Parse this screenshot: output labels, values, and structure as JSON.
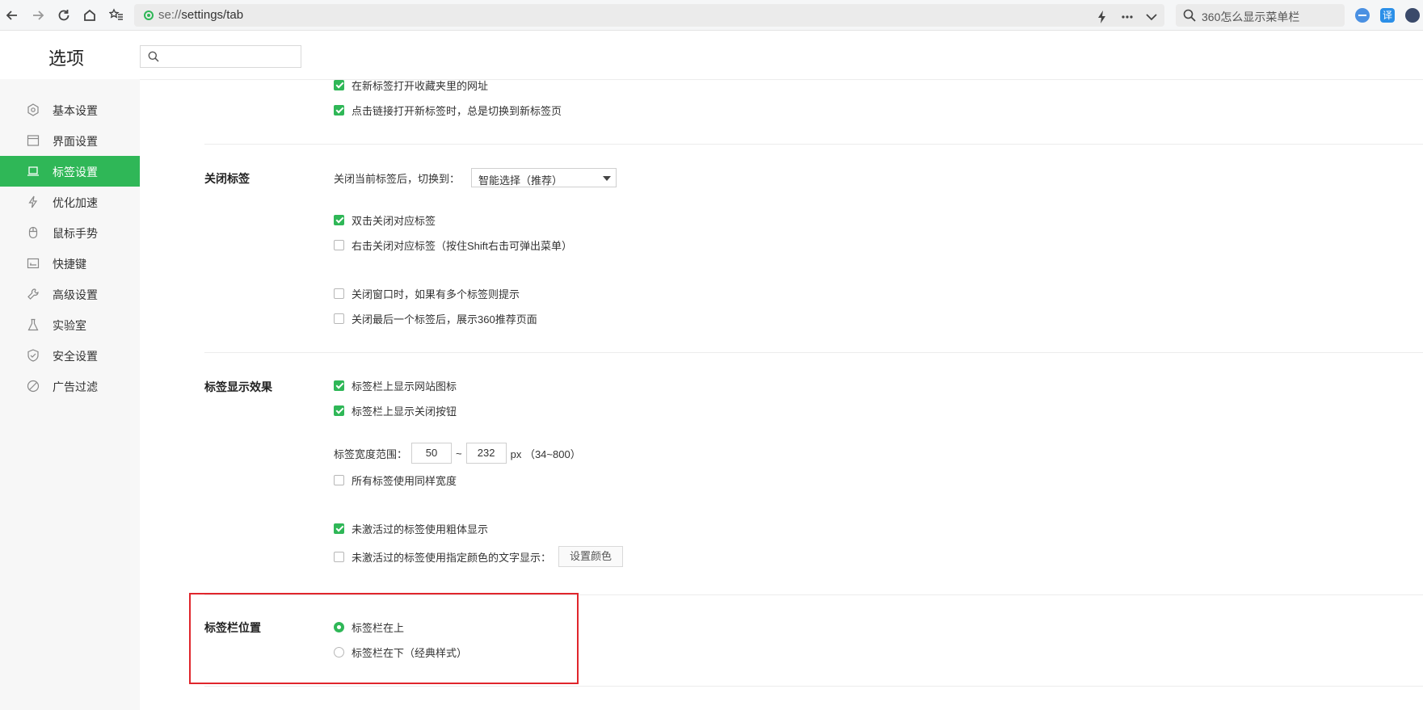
{
  "browser": {
    "url_scheme": "se://",
    "url_rest": "settings/tab",
    "search_text": "360怎么显示菜单栏",
    "translate_label": "译"
  },
  "header": {
    "title": "选项",
    "search_placeholder": ""
  },
  "sidebar": {
    "items": [
      {
        "label": "基本设置",
        "icon": "gear-icon"
      },
      {
        "label": "界面设置",
        "icon": "window-icon"
      },
      {
        "label": "标签设置",
        "icon": "tab-icon",
        "active": true
      },
      {
        "label": "优化加速",
        "icon": "lightning-icon"
      },
      {
        "label": "鼠标手势",
        "icon": "mouse-icon"
      },
      {
        "label": "快捷键",
        "icon": "keyboard-icon"
      },
      {
        "label": "高级设置",
        "icon": "wrench-icon"
      },
      {
        "label": "实验室",
        "icon": "flask-icon"
      },
      {
        "label": "安全设置",
        "icon": "shield-icon"
      },
      {
        "label": "广告过滤",
        "icon": "block-icon"
      }
    ]
  },
  "open_section": {
    "items": [
      {
        "label": "在新标签打开收藏夹里的网址",
        "checked": true
      },
      {
        "label": "点击链接打开新标签时，总是切换到新标签页",
        "checked": true
      }
    ]
  },
  "close_section": {
    "title": "关闭标签",
    "switch_label": "关闭当前标签后，切换到：",
    "switch_value": "智能选择（推荐）",
    "items": [
      {
        "label": "双击关闭对应标签",
        "checked": true
      },
      {
        "label": "右击关闭对应标签（按住Shift右击可弹出菜单）",
        "checked": false
      },
      {
        "label": "关闭窗口时，如果有多个标签则提示",
        "checked": false
      },
      {
        "label": "关闭最后一个标签后，展示360推荐页面",
        "checked": false
      }
    ]
  },
  "display_section": {
    "title": "标签显示效果",
    "items": [
      {
        "label": "标签栏上显示网站图标",
        "checked": true
      },
      {
        "label": "标签栏上显示关闭按钮",
        "checked": true
      }
    ],
    "width_label": "标签宽度范围：",
    "width_min": "50",
    "width_sep": "~",
    "width_max": "232",
    "width_unit": "px （34~800）",
    "same_width": {
      "label": "所有标签使用同样宽度",
      "checked": false
    },
    "bold_inactive": {
      "label": "未激活过的标签使用粗体显示",
      "checked": true
    },
    "color_inactive": {
      "label": "未激活过的标签使用指定颜色的文字显示：",
      "checked": false
    },
    "color_button": "设置颜色"
  },
  "position_section": {
    "title": "标签栏位置",
    "options": [
      {
        "label": "标签栏在上",
        "selected": true
      },
      {
        "label": "标签栏在下（经典样式）",
        "selected": false
      }
    ]
  },
  "colors": {
    "accent": "#2fb757",
    "highlight": "#e0262c"
  }
}
